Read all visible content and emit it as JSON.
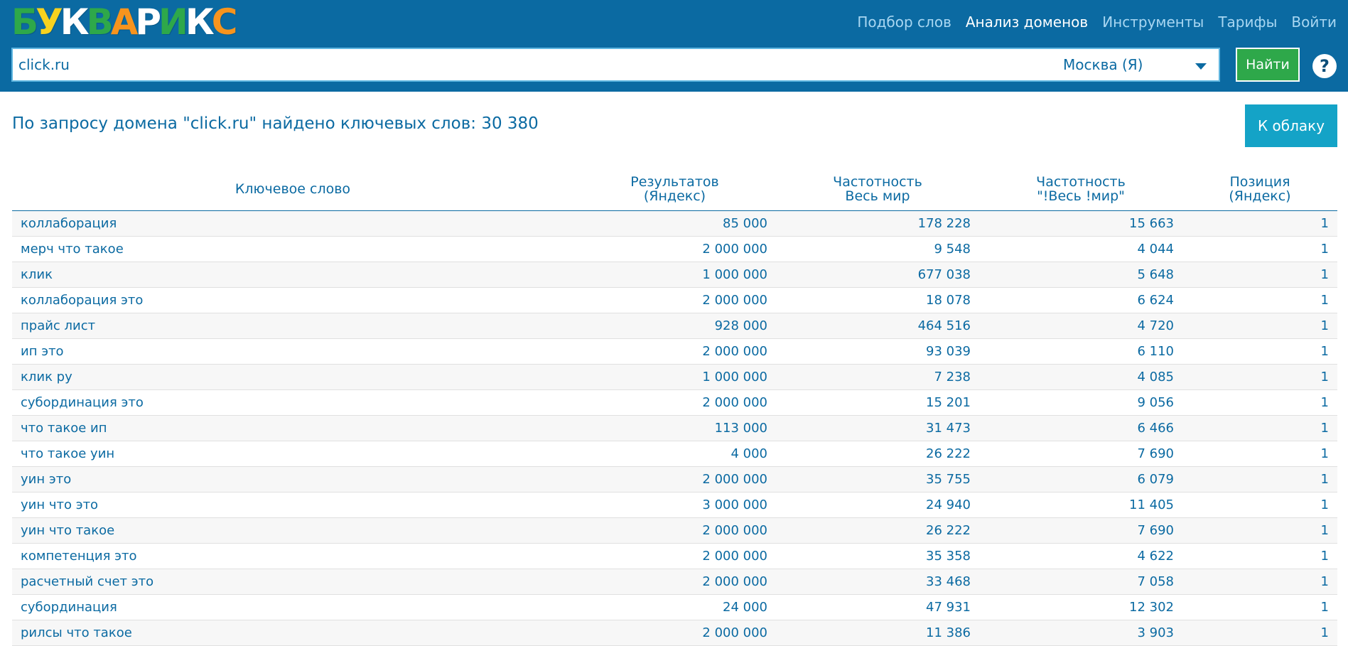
{
  "header": {
    "logo_letters": [
      {
        "ch": "Б",
        "color": "#2ea84a"
      },
      {
        "ch": "У",
        "color": "#f7d21e"
      },
      {
        "ch": "К",
        "color": "#ffffff"
      },
      {
        "ch": "В",
        "color": "#2ea84a"
      },
      {
        "ch": "А",
        "color": "#f7941d"
      },
      {
        "ch": "Р",
        "color": "#ffffff"
      },
      {
        "ch": "И",
        "color": "#2ea84a"
      },
      {
        "ch": "К",
        "color": "#ffffff"
      },
      {
        "ch": "С",
        "color": "#f7941d"
      }
    ],
    "nav": [
      {
        "label": "Подбор слов",
        "active": false
      },
      {
        "label": "Анализ доменов",
        "active": true
      },
      {
        "label": "Инструменты",
        "active": false
      },
      {
        "label": "Тарифы",
        "active": false
      },
      {
        "label": "Войти",
        "active": false
      }
    ]
  },
  "search": {
    "value": "click.ru",
    "region": "Москва (Я)",
    "button_label": "Найти",
    "help_label": "?"
  },
  "result_title": "По запросу домена \"click.ru\" найдено ключевых слов: 30 380",
  "cloud_button": "К облаку",
  "table": {
    "headers": [
      "Ключевое слово",
      "Результатов (Яндекс)",
      "Частотность Весь мир",
      "Частотность \"!Весь !мир\"",
      "Позиция (Яндекс)"
    ],
    "rows": [
      [
        "коллаборация",
        "85 000",
        "178 228",
        "15 663",
        "1"
      ],
      [
        "мерч что такое",
        "2 000 000",
        "9 548",
        "4 044",
        "1"
      ],
      [
        "клик",
        "1 000 000",
        "677 038",
        "5 648",
        "1"
      ],
      [
        "коллаборация это",
        "2 000 000",
        "18 078",
        "6 624",
        "1"
      ],
      [
        "прайс лист",
        "928 000",
        "464 516",
        "4 720",
        "1"
      ],
      [
        "ип это",
        "2 000 000",
        "93 039",
        "6 110",
        "1"
      ],
      [
        "клик ру",
        "1 000 000",
        "7 238",
        "4 085",
        "1"
      ],
      [
        "субординация это",
        "2 000 000",
        "15 201",
        "9 056",
        "1"
      ],
      [
        "что такое ип",
        "113 000",
        "31 473",
        "6 466",
        "1"
      ],
      [
        "что такое уин",
        "4 000",
        "26 222",
        "7 690",
        "1"
      ],
      [
        "уин это",
        "2 000 000",
        "35 755",
        "6 079",
        "1"
      ],
      [
        "уин что это",
        "3 000 000",
        "24 940",
        "11 405",
        "1"
      ],
      [
        "уин что такое",
        "2 000 000",
        "26 222",
        "7 690",
        "1"
      ],
      [
        "компетенция это",
        "2 000 000",
        "35 358",
        "4 622",
        "1"
      ],
      [
        "расчетный счет это",
        "2 000 000",
        "33 468",
        "7 058",
        "1"
      ],
      [
        "субординация",
        "24 000",
        "47 931",
        "12 302",
        "1"
      ],
      [
        "рилсы что такое",
        "2 000 000",
        "11 386",
        "3 903",
        "1"
      ]
    ]
  }
}
